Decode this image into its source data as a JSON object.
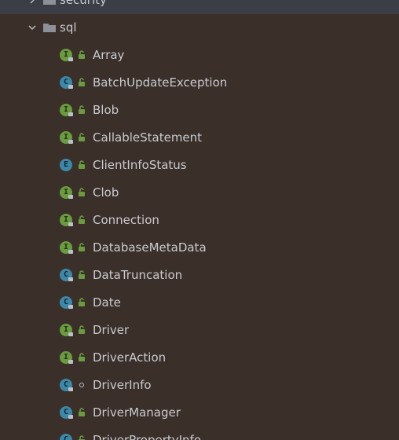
{
  "tree": {
    "previous_folder": {
      "label": "security"
    },
    "current_folder": {
      "label": "sql"
    },
    "items": [
      {
        "label": "Array",
        "kind": "I",
        "visibility": "public"
      },
      {
        "label": "BatchUpdateException",
        "kind": "C",
        "visibility": "public"
      },
      {
        "label": "Blob",
        "kind": "I",
        "visibility": "public"
      },
      {
        "label": "CallableStatement",
        "kind": "I",
        "visibility": "public"
      },
      {
        "label": "ClientInfoStatus",
        "kind": "E",
        "visibility": "public"
      },
      {
        "label": "Clob",
        "kind": "I",
        "visibility": "public"
      },
      {
        "label": "Connection",
        "kind": "I",
        "visibility": "public"
      },
      {
        "label": "DatabaseMetaData",
        "kind": "I",
        "visibility": "public"
      },
      {
        "label": "DataTruncation",
        "kind": "C",
        "visibility": "public"
      },
      {
        "label": "Date",
        "kind": "C",
        "visibility": "public"
      },
      {
        "label": "Driver",
        "kind": "I",
        "visibility": "public"
      },
      {
        "label": "DriverAction",
        "kind": "I",
        "visibility": "public"
      },
      {
        "label": "DriverInfo",
        "kind": "C",
        "visibility": "package"
      },
      {
        "label": "DriverManager",
        "kind": "C",
        "visibility": "public"
      },
      {
        "label": "DriverPropertyInfo",
        "kind": "C",
        "visibility": "public"
      }
    ]
  },
  "colors": {
    "background": "#3b3029",
    "text": "#c7cbd1",
    "interface_badge": "#6a9c3f",
    "class_badge": "#3d88a8",
    "visibility_public": "#6a9c3f"
  }
}
